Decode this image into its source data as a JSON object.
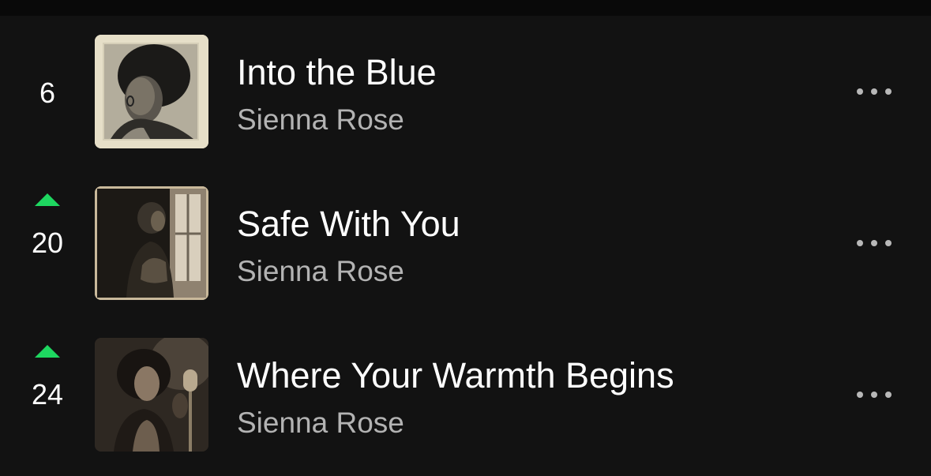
{
  "colors": {
    "background": "#121212",
    "title": "#ffffff",
    "artist": "#b3b3b3",
    "trend_up": "#1ed760"
  },
  "tracks": [
    {
      "rank": "6",
      "trend": "none",
      "title": "Into the Blue",
      "artist": "Sienna Rose",
      "cover_icon": "album-cover-woman-portrait"
    },
    {
      "rank": "20",
      "trend": "up",
      "title": "Safe With You",
      "artist": "Sienna Rose",
      "cover_icon": "album-cover-woman-window"
    },
    {
      "rank": "24",
      "trend": "up",
      "title": "Where Your Warmth Begins",
      "artist": "Sienna Rose",
      "cover_icon": "album-cover-woman-microphone"
    }
  ]
}
